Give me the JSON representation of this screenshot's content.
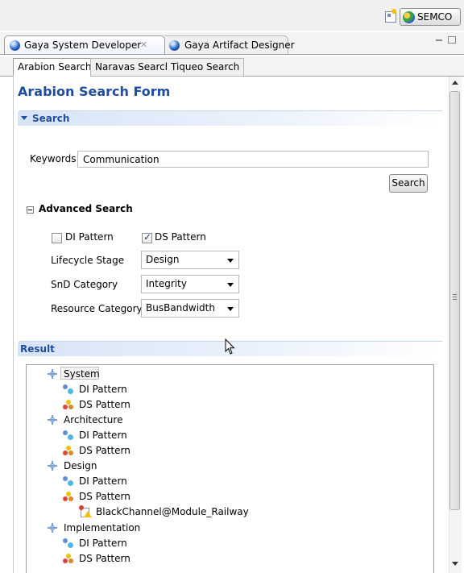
{
  "toolbar": {
    "perspective": "SEMCO"
  },
  "editor_tabs": [
    {
      "label": "Gaya System Developer"
    },
    {
      "label": "Gaya Artifact Designer"
    }
  ],
  "inner_tabs": [
    {
      "label": "Arabion Search"
    },
    {
      "label": "Naravas Search"
    },
    {
      "label": "Tiqueo Search"
    }
  ],
  "form": {
    "title": "Arabion Search Form",
    "search_section": "Search",
    "keywords_label": "Keywords",
    "keywords_value": "Communication",
    "search_button": "Search",
    "advanced_title": "Advanced Search",
    "di_pattern_label": "DI Pattern",
    "di_pattern_checked": false,
    "ds_pattern_label": "DS Pattern",
    "ds_pattern_checked": true,
    "lifecycle_label": "Lifecycle Stage",
    "lifecycle_value": "Design",
    "snd_label": "SnD Category",
    "snd_value": "Integrity",
    "resource_label": "Resource Category",
    "resource_value": "BusBandwidth"
  },
  "result": {
    "title": "Result",
    "tree": [
      {
        "label": "System",
        "icon": "category",
        "level": 0,
        "selected": true
      },
      {
        "label": "DI Pattern",
        "icon": "di",
        "level": 1
      },
      {
        "label": "DS Pattern",
        "icon": "ds",
        "level": 1
      },
      {
        "label": "Architecture",
        "icon": "category",
        "level": 0
      },
      {
        "label": "DI Pattern",
        "icon": "di",
        "level": 1
      },
      {
        "label": "DS Pattern",
        "icon": "ds",
        "level": 1
      },
      {
        "label": "Design",
        "icon": "category",
        "level": 0
      },
      {
        "label": "DI Pattern",
        "icon": "di",
        "level": 1
      },
      {
        "label": "DS Pattern",
        "icon": "ds",
        "level": 1
      },
      {
        "label": "BlackChannel@Module_Railway",
        "icon": "resource",
        "level": 2
      },
      {
        "label": "Implementation",
        "icon": "category",
        "level": 0
      },
      {
        "label": "DI Pattern",
        "icon": "di",
        "level": 1
      },
      {
        "label": "DS Pattern",
        "icon": "ds",
        "level": 1
      }
    ]
  },
  "colors": {
    "accent": "#1f4d9e",
    "section_bar": "#d7e4f6"
  }
}
